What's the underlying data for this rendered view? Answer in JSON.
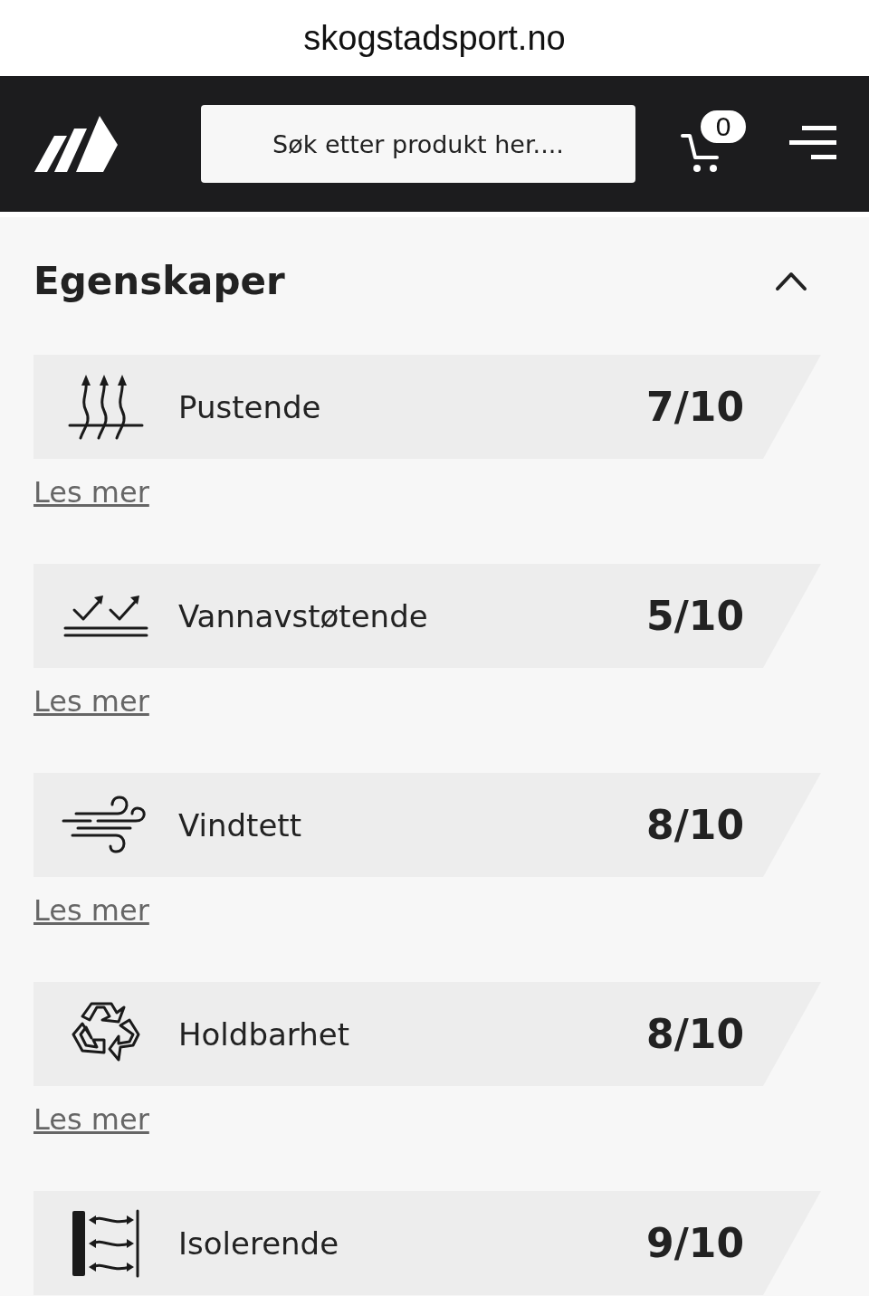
{
  "address_bar": {
    "url": "skogstadsport.no"
  },
  "header": {
    "search": {
      "placeholder": "Søk etter produkt her...."
    },
    "cart": {
      "count": "0"
    }
  },
  "section": {
    "title": "Egenskaper",
    "expanded": true
  },
  "properties": [
    {
      "kind": "breathable",
      "label": "Pustende",
      "score": "7/10",
      "link": "Les mer"
    },
    {
      "kind": "water",
      "label": "Vannavstøtende",
      "score": "5/10",
      "link": "Les mer"
    },
    {
      "kind": "wind",
      "label": "Vindtett",
      "score": "8/10",
      "link": "Les mer"
    },
    {
      "kind": "recycle",
      "label": "Holdbarhet",
      "score": "8/10",
      "link": "Les mer"
    },
    {
      "kind": "insulation",
      "label": "Isolerende",
      "score": "9/10"
    }
  ]
}
